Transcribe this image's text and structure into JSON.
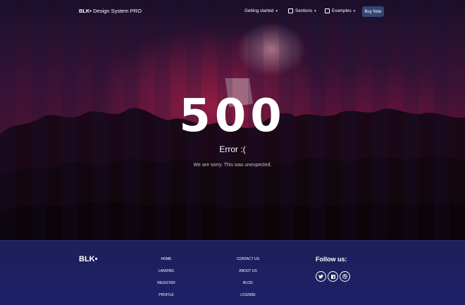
{
  "navbar": {
    "brand_bold": "BLK•",
    "brand_rest": " Design System PRO",
    "items": [
      {
        "label": "Getting started",
        "icon": "none"
      },
      {
        "label": "Sections",
        "icon": "sections-icon"
      },
      {
        "label": "Examples",
        "icon": "examples-icon"
      }
    ],
    "buy_label": "Buy Now"
  },
  "error": {
    "code": "500",
    "title": "Error :(",
    "description": "We are sorry. This was unexpected."
  },
  "footer": {
    "brand": "BLK•",
    "col1": [
      "HOME",
      "LANDING",
      "REGISTER",
      "PROFILE"
    ],
    "col2": [
      "CONTACT US",
      "ABOUT US",
      "BLOG",
      "LICENSE"
    ],
    "follow_label": "Follow us:",
    "social": [
      "twitter-icon",
      "facebook-icon",
      "dribbble-icon"
    ]
  },
  "colors": {
    "footer_bg": "#1e1f5a",
    "button_bg": "#344675"
  }
}
